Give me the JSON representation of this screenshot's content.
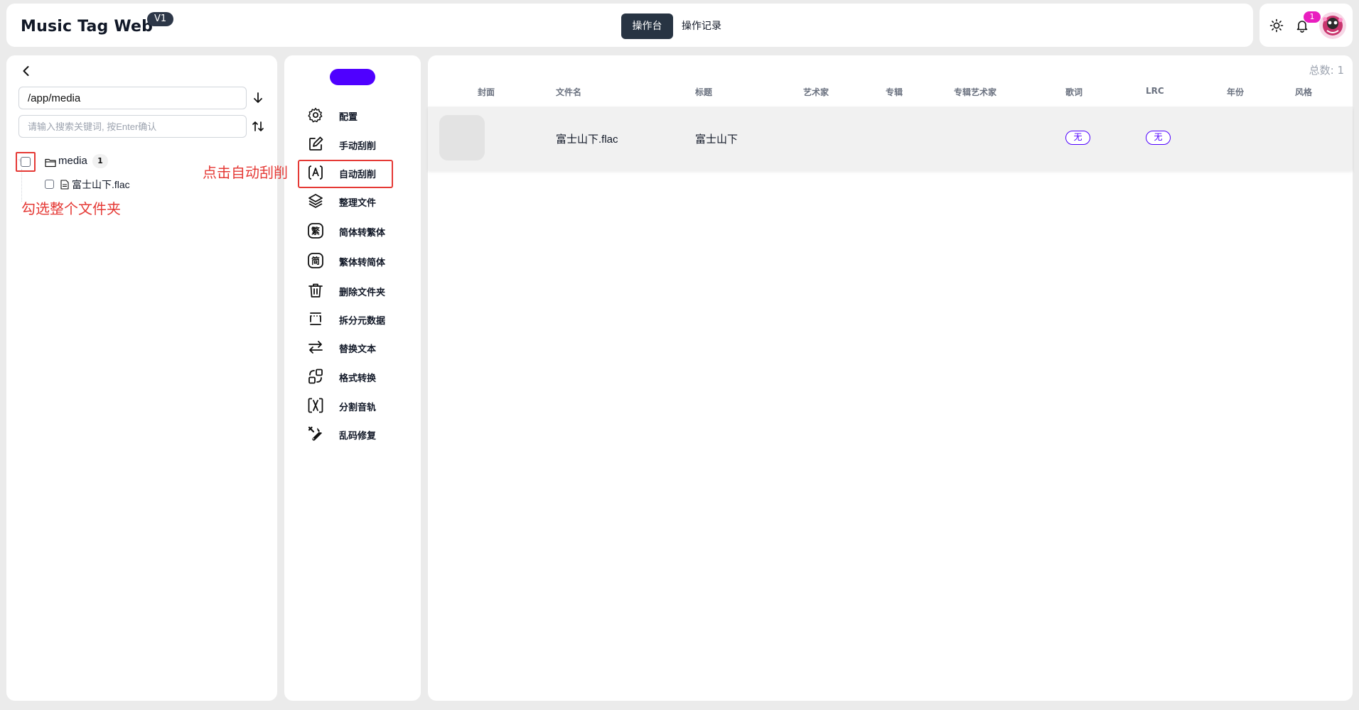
{
  "header": {
    "title": "Music Tag Web",
    "version": "V1",
    "tabs": [
      {
        "label": "操作台",
        "active": true
      },
      {
        "label": "操作记录",
        "active": false
      }
    ],
    "notifications_count": "1",
    "icons": {
      "theme": "sun-icon",
      "notifications": "bell-icon",
      "avatar": "avatar"
    }
  },
  "file_panel": {
    "path_value": "/app/media",
    "search_placeholder": "请输入搜索关键词, 按Enter确认",
    "tree": {
      "folder": {
        "name": "media",
        "count": "1",
        "checked": false
      },
      "files": [
        {
          "name": "富士山下.flac",
          "checked": false
        }
      ]
    },
    "annotation": "勾选整个文件夹"
  },
  "actions": {
    "items": [
      {
        "label": "配置",
        "icon": "gear-icon"
      },
      {
        "label": "手动刮削",
        "icon": "edit-icon"
      },
      {
        "label": "自动刮削",
        "icon": "auto-scrape-icon"
      },
      {
        "label": "整理文件",
        "icon": "layers-icon"
      },
      {
        "label": "简体转繁体",
        "icon": "traditional-icon"
      },
      {
        "label": "繁体转简体",
        "icon": "simplified-icon"
      },
      {
        "label": "删除文件夹",
        "icon": "trash-icon"
      },
      {
        "label": "拆分元数据",
        "icon": "split-icon"
      },
      {
        "label": "替换文本",
        "icon": "swap-icon"
      },
      {
        "label": "格式转换",
        "icon": "convert-icon"
      },
      {
        "label": "分割音轨",
        "icon": "cut-track-icon"
      },
      {
        "label": "乱码修复",
        "icon": "wrench-icon"
      }
    ],
    "annotation": "点击自动刮削",
    "accent": "#4f00ff"
  },
  "table": {
    "total": "总数: 1",
    "columns": [
      "封面",
      "文件名",
      "标题",
      "艺术家",
      "专辑",
      "专辑艺术家",
      "歌词",
      "LRC",
      "年份",
      "风格"
    ],
    "rows": [
      {
        "filename": "富士山下.flac",
        "title": "富士山下",
        "artist": "",
        "album": "",
        "album_artist": "",
        "lyrics": "无",
        "lrc": "无",
        "year": "",
        "genre": ""
      }
    ]
  },
  "colors": {
    "annotation": "#e53935",
    "accent": "#4f00ff",
    "active_tab": "#283443",
    "badge": "#e91ebf"
  }
}
